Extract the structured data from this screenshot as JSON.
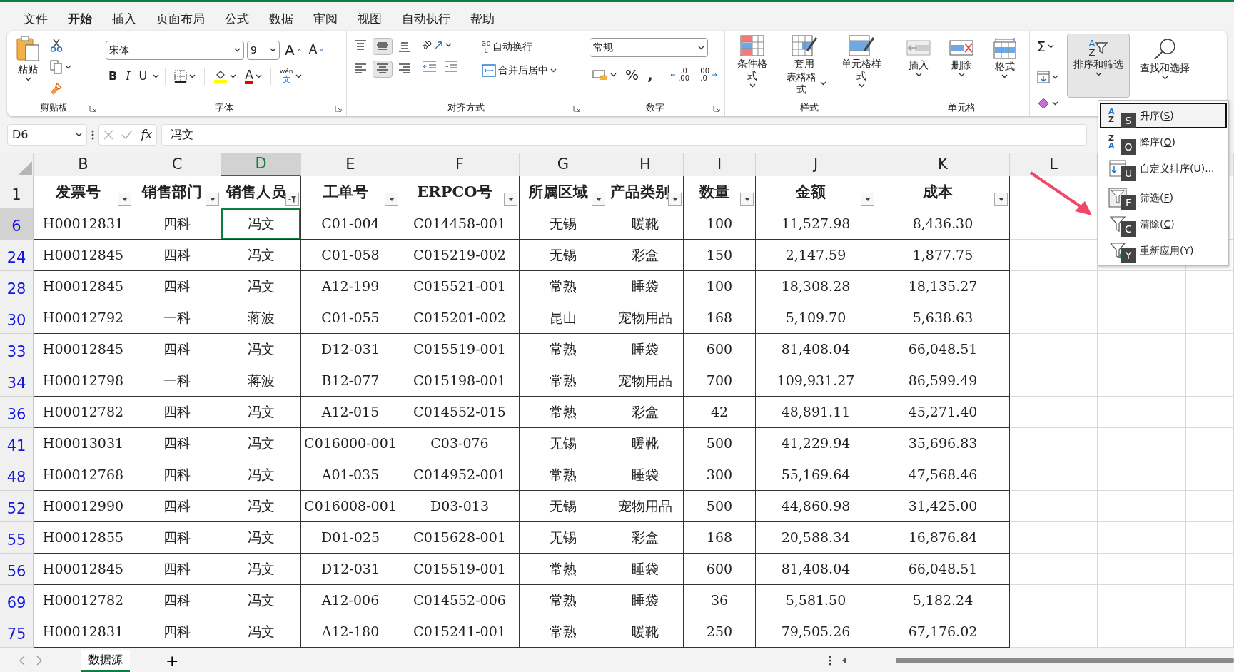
{
  "menu_tabs": [
    {
      "label": "文件",
      "selected": false
    },
    {
      "label": "开始",
      "selected": true
    },
    {
      "label": "插入",
      "selected": false
    },
    {
      "label": "页面布局",
      "selected": false
    },
    {
      "label": "公式",
      "selected": false
    },
    {
      "label": "数据",
      "selected": false
    },
    {
      "label": "审阅",
      "selected": false
    },
    {
      "label": "视图",
      "selected": false
    },
    {
      "label": "自动执行",
      "selected": false
    },
    {
      "label": "帮助",
      "selected": false
    }
  ],
  "ribbon": {
    "clipboard": {
      "paste": "粘贴",
      "label": "剪贴板"
    },
    "font": {
      "family": "宋体",
      "size": "9",
      "grow": "A",
      "shrink": "A",
      "bold": "B",
      "italic": "I",
      "underline": "U",
      "font_color": "A",
      "phonetic_top": "wén",
      "phonetic_bottom": "文",
      "label": "字体"
    },
    "alignment": {
      "vertical_align": [
        {
          "pressed": false
        },
        {
          "pressed": true
        },
        {
          "pressed": false
        }
      ],
      "horizontal_align": [
        {
          "pressed": false
        },
        {
          "pressed": true
        },
        {
          "pressed": false
        }
      ],
      "orientation_icon": "ab",
      "wrap_icon_top": "ab",
      "wrap_icon_bottom": "c",
      "wrap_text": "自动换行",
      "merge": "合并后居中",
      "label": "对齐方式"
    },
    "number": {
      "format": "常规",
      "percent": "%",
      "comma": ",",
      "inc_top": ".0",
      "inc_bottom": ".00",
      "dec_top": ".00",
      "dec_bottom": ".0",
      "label": "数字"
    },
    "styles": {
      "conditional": "条件格式",
      "table_1": "套用",
      "table_2": "表格格式",
      "cell_styles": "单元格样式",
      "label": "样式"
    },
    "cells": {
      "insert": "插入",
      "delete": "删除",
      "format": "格式",
      "label": "单元格"
    },
    "editing": {
      "sum": "Σ",
      "sort": {
        "label": "排序和筛选",
        "pressed": true,
        "icon_top": "A",
        "icon_bottom": "Z"
      },
      "find": "查找和选择"
    }
  },
  "formula_bar": {
    "name_box": "D6",
    "fx": "fx",
    "formula": "冯文"
  },
  "sheet": {
    "columns": [
      {
        "letter": "B",
        "selected": false
      },
      {
        "letter": "C",
        "selected": false
      },
      {
        "letter": "D",
        "selected": true
      },
      {
        "letter": "E",
        "selected": false
      },
      {
        "letter": "F",
        "selected": false
      },
      {
        "letter": "G",
        "selected": false
      },
      {
        "letter": "H",
        "selected": false
      },
      {
        "letter": "I",
        "selected": false
      },
      {
        "letter": "J",
        "selected": false
      },
      {
        "letter": "K",
        "selected": false
      },
      {
        "letter": "L",
        "selected": false
      }
    ],
    "header_row": {
      "number": "1",
      "cells": [
        {
          "text": "发票号",
          "filtered": false
        },
        {
          "text": "销售部门",
          "filtered": false
        },
        {
          "text": "销售人员",
          "filtered": true
        },
        {
          "text": "工单号",
          "filtered": false
        },
        {
          "text": "ERPCO号",
          "filtered": false
        },
        {
          "text": "所属区域",
          "filtered": false
        },
        {
          "text": "产品类别",
          "filtered": false
        },
        {
          "text": "数量",
          "filtered": false
        },
        {
          "text": "金额",
          "filtered": false
        },
        {
          "text": "成本",
          "filtered": false
        }
      ]
    },
    "rows": [
      {
        "number": "6",
        "selected": true,
        "cells": [
          "H00012831",
          "四科",
          "冯文",
          "C01-004",
          "C014458-001",
          "无锡",
          "暖靴",
          "100",
          "11,527.98",
          "8,436.30"
        ]
      },
      {
        "number": "24",
        "selected": false,
        "cells": [
          "H00012845",
          "四科",
          "冯文",
          "C01-058",
          "C015219-002",
          "无锡",
          "彩盒",
          "150",
          "2,147.59",
          "1,877.75"
        ]
      },
      {
        "number": "28",
        "selected": false,
        "cells": [
          "H00012845",
          "四科",
          "冯文",
          "A12-199",
          "C015521-001",
          "常熟",
          "睡袋",
          "100",
          "18,308.28",
          "18,135.27"
        ]
      },
      {
        "number": "30",
        "selected": false,
        "cells": [
          "H00012792",
          "一科",
          "蒋波",
          "C01-055",
          "C015201-002",
          "昆山",
          "宠物用品",
          "168",
          "5,109.70",
          "5,638.63"
        ]
      },
      {
        "number": "33",
        "selected": false,
        "cells": [
          "H00012845",
          "四科",
          "冯文",
          "D12-031",
          "C015519-001",
          "常熟",
          "睡袋",
          "600",
          "81,408.04",
          "66,048.51"
        ]
      },
      {
        "number": "34",
        "selected": false,
        "cells": [
          "H00012798",
          "一科",
          "蒋波",
          "B12-077",
          "C015198-001",
          "常熟",
          "宠物用品",
          "700",
          "109,931.27",
          "86,599.49"
        ]
      },
      {
        "number": "36",
        "selected": false,
        "cells": [
          "H00012782",
          "四科",
          "冯文",
          "A12-015",
          "C014552-015",
          "常熟",
          "彩盒",
          "42",
          "48,891.11",
          "45,271.40"
        ]
      },
      {
        "number": "41",
        "selected": false,
        "cells": [
          "H00013031",
          "四科",
          "冯文",
          "C016000-001",
          "C03-076",
          "无锡",
          "暖靴",
          "500",
          "41,229.94",
          "35,696.83"
        ]
      },
      {
        "number": "48",
        "selected": false,
        "cells": [
          "H00012768",
          "四科",
          "冯文",
          "A01-035",
          "C014952-001",
          "常熟",
          "睡袋",
          "300",
          "55,169.64",
          "47,568.46"
        ]
      },
      {
        "number": "52",
        "selected": false,
        "cells": [
          "H00012990",
          "四科",
          "冯文",
          "C016008-001",
          "D03-013",
          "无锡",
          "宠物用品",
          "500",
          "44,860.98",
          "31,425.00"
        ]
      },
      {
        "number": "55",
        "selected": false,
        "cells": [
          "H00012855",
          "四科",
          "冯文",
          "D01-025",
          "C015628-001",
          "无锡",
          "彩盒",
          "168",
          "20,588.34",
          "16,876.84"
        ]
      },
      {
        "number": "56",
        "selected": false,
        "cells": [
          "H00012845",
          "四科",
          "冯文",
          "D12-031",
          "C015519-001",
          "常熟",
          "睡袋",
          "600",
          "81,408.04",
          "66,048.51"
        ]
      },
      {
        "number": "69",
        "selected": false,
        "cells": [
          "H00012782",
          "四科",
          "冯文",
          "A12-006",
          "C014552-006",
          "常熟",
          "睡袋",
          "36",
          "5,581.50",
          "5,182.24"
        ]
      },
      {
        "number": "75",
        "selected": false,
        "cells": [
          "H00012831",
          "四科",
          "冯文",
          "A12-180",
          "C015241-001",
          "常熟",
          "暖靴",
          "250",
          "79,505.26",
          "67,176.02"
        ]
      }
    ]
  },
  "sort_menu": {
    "items": [
      {
        "kind": "az",
        "icon_top": "A",
        "icon_bottom": "Z",
        "keytip": "S",
        "before": "升序(",
        "key": "S",
        "after": ")",
        "selected": true
      },
      {
        "kind": "za",
        "icon_top": "Z",
        "icon_bottom": "A",
        "keytip": "O",
        "before": "降序(",
        "key": "O",
        "after": ")",
        "selected": false
      },
      {
        "kind": "custom",
        "keytip": "U",
        "before": "自定义排序(",
        "key": "U",
        "after": ")...",
        "selected": false
      },
      {
        "kind": "filter",
        "keytip": "F",
        "before": "筛选(",
        "key": "F",
        "after": ")",
        "selected": false
      },
      {
        "kind": "clear",
        "keytip": "C",
        "before": "清除(",
        "key": "C",
        "after": ")",
        "selected": false
      },
      {
        "kind": "reapply",
        "keytip": "Y",
        "before": "重新应用(",
        "key": "Y",
        "after": ")",
        "selected": false
      }
    ]
  },
  "sheet_tabs": {
    "tabs": [
      {
        "label": "数据源",
        "selected": true
      }
    ],
    "add": "+"
  }
}
